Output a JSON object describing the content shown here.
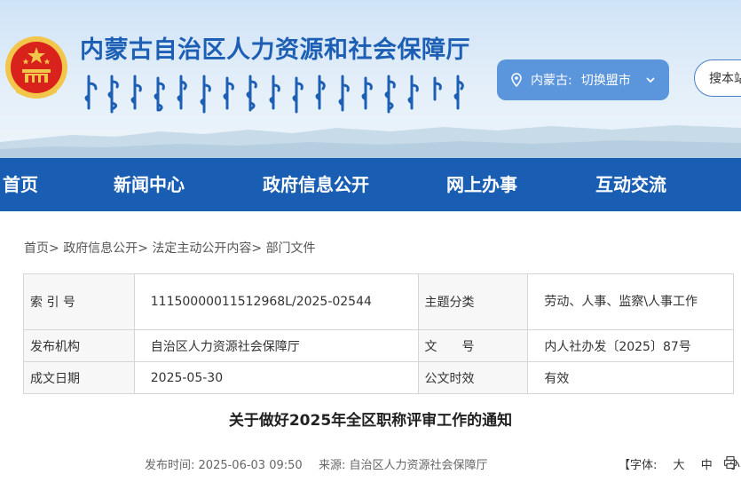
{
  "header": {
    "site_title": "内蒙古自治区人力资源和社会保障厅",
    "region_label": "内蒙古:",
    "region_switch": "切换盟市",
    "search_label": "搜本站"
  },
  "nav": {
    "items": [
      "首页",
      "新闻中心",
      "政府信息公开",
      "网上办事",
      "互动交流"
    ]
  },
  "breadcrumb": {
    "items": [
      "首页",
      "政府信息公开",
      "法定主动公开内容",
      "部门文件"
    ],
    "separator": ">"
  },
  "info_table": {
    "rows": [
      {
        "label1": "索 引 号",
        "value1": "11150000011512968L/2025-02544",
        "label2": "主题分类",
        "value2": "劳动、人事、监察\\人事工作"
      },
      {
        "label1": "发布机构",
        "value1": "自治区人力资源社会保障厅",
        "label2": "文　　号",
        "value2": "内人社办发〔2025〕87号"
      },
      {
        "label1": "成文日期",
        "value1": "2025-05-30",
        "label2": "公文时效",
        "value2": "有效"
      }
    ]
  },
  "document": {
    "title": "关于做好2025年全区职称评审工作的通知",
    "publish_label": "发布时间:",
    "publish_time": "2025-06-03 09:50",
    "source_label": "来源:",
    "source": "自治区人力资源社会保障厅"
  },
  "font_size": {
    "label": "【字体:",
    "options": [
      "大",
      "中",
      "小"
    ],
    "close": "】"
  },
  "colors": {
    "primary": "#1a5eb4",
    "title_blue": "#1d5fb4",
    "region_button": "#5b96dc",
    "emblem_red": "#d9221c",
    "emblem_gold": "#f2c64a"
  }
}
